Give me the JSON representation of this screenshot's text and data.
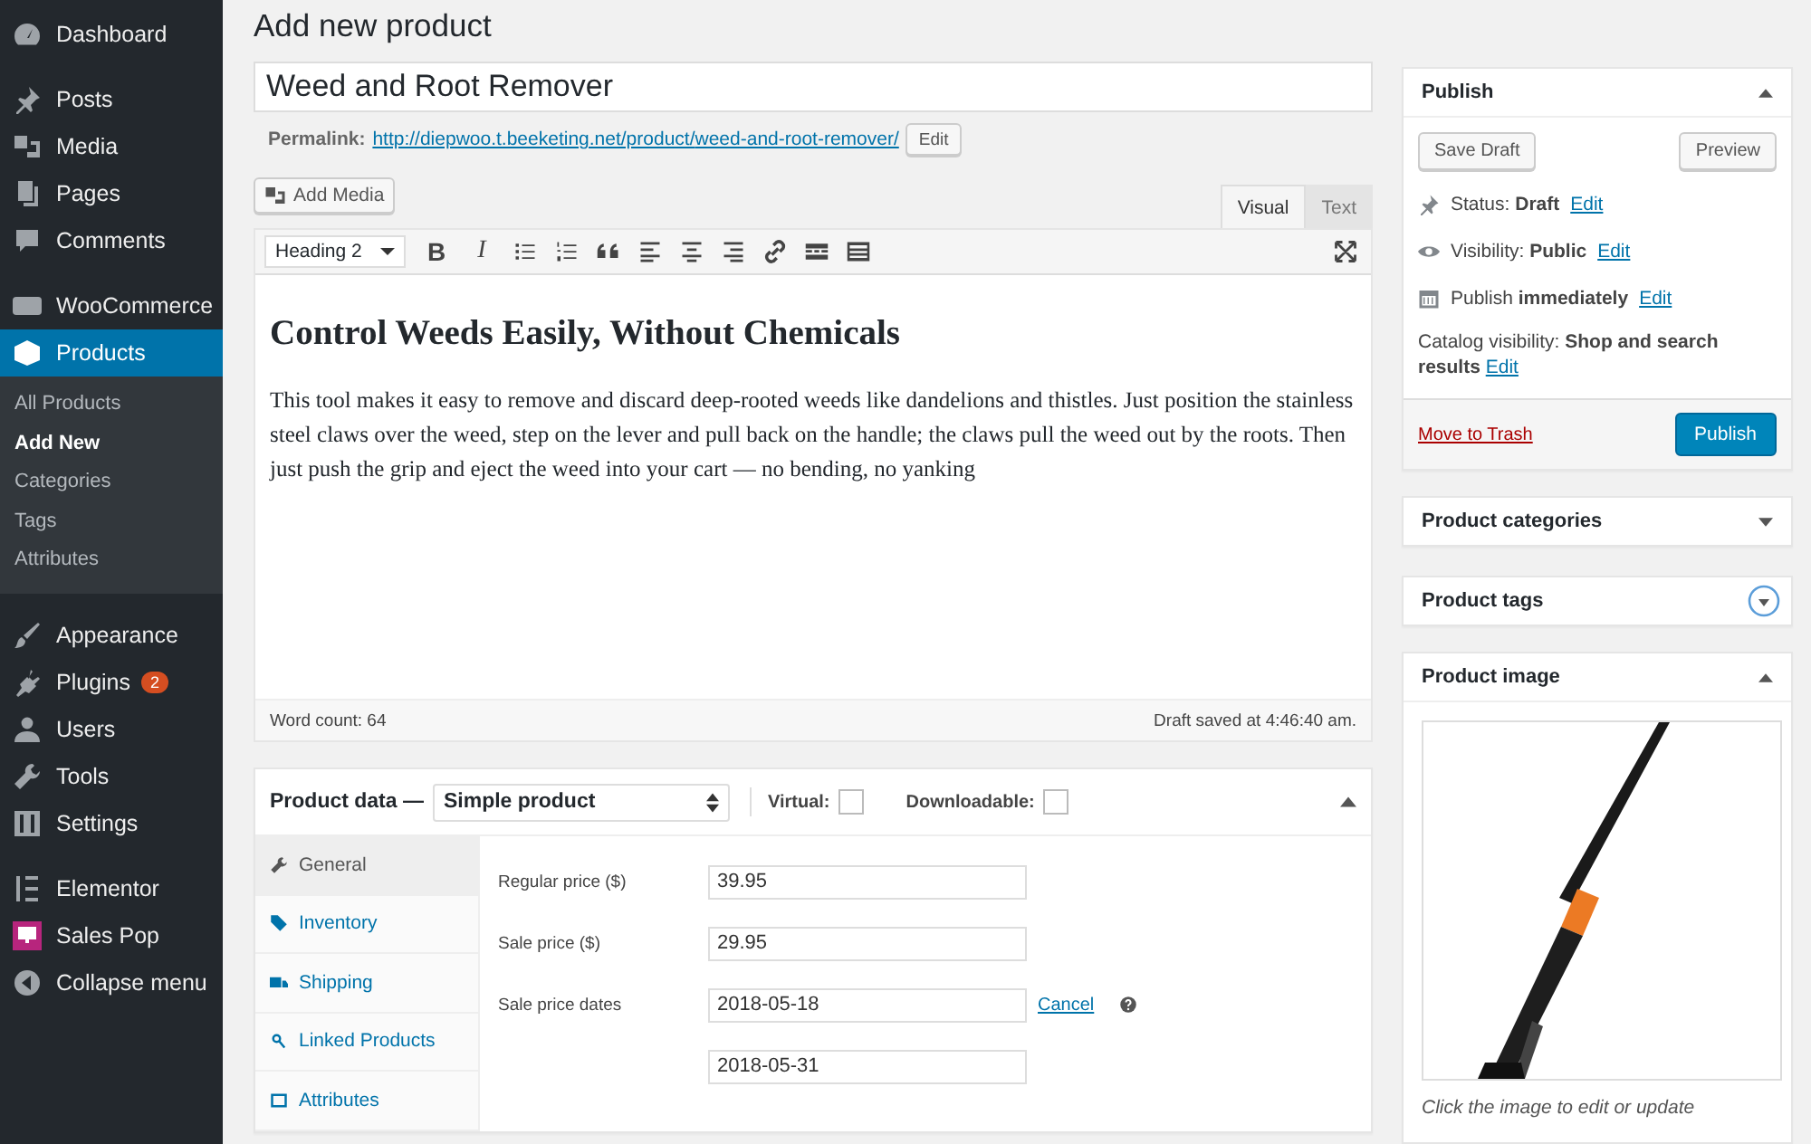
{
  "sidebar": {
    "groups": [
      [
        {
          "label": "Dashboard",
          "selected": false
        }
      ],
      [
        {
          "label": "Posts",
          "selected": false
        },
        {
          "label": "Media",
          "selected": false
        },
        {
          "label": "Pages",
          "selected": false
        },
        {
          "label": "Comments",
          "selected": false
        }
      ],
      [
        {
          "label": "WooCommerce",
          "selected": false
        },
        {
          "label": "Products",
          "selected": true,
          "children": [
            {
              "label": "All Products",
              "selected": false
            },
            {
              "label": "Add New",
              "selected": true
            },
            {
              "label": "Categories",
              "selected": false
            },
            {
              "label": "Tags",
              "selected": false
            },
            {
              "label": "Attributes",
              "selected": false
            }
          ]
        }
      ],
      [
        {
          "label": "Appearance",
          "selected": false
        },
        {
          "label": "Plugins",
          "selected": false,
          "badge": "2"
        },
        {
          "label": "Users",
          "selected": false
        },
        {
          "label": "Tools",
          "selected": false
        },
        {
          "label": "Settings",
          "selected": false
        }
      ],
      [
        {
          "label": "Elementor",
          "selected": false
        },
        {
          "label": "Sales Pop",
          "selected": false
        },
        {
          "label": "Collapse menu",
          "selected": false
        }
      ]
    ]
  },
  "page_title": "Add new product",
  "product_title": "Weed and Root Remover",
  "permalink": {
    "label": "Permalink:",
    "url_base": "http://diepwoo.t.beeketing.net/product/",
    "slug": "weed-and-root-remover/",
    "button": "Edit"
  },
  "editor": {
    "add_media": "Add Media",
    "tabs": [
      {
        "label": "Visual",
        "selected": true
      },
      {
        "label": "Text",
        "selected": false
      }
    ],
    "toolbar": {
      "format": "Heading 2",
      "bold": "B",
      "italic": "I"
    },
    "heading": "Control Weeds Easily, Without Chemicals",
    "body": "This tool makes it easy to remove and discard deep-rooted weeds like dandelions and thistles. Just position the stainless steel claws over the weed, step on the lever and pull back on the handle; the claws pull the weed out by the roots. Then just push the grip and eject the weed into your cart — no bending, no yanking",
    "word_count": "Word count: 64",
    "saved": "Draft saved at 4:46:40 am."
  },
  "product_data": {
    "label": "Product data —",
    "type": "Simple product",
    "virtual": {
      "label": "Virtual:",
      "checked": false
    },
    "downloadable": {
      "label": "Downloadable:",
      "checked": false
    },
    "tabs": [
      {
        "label": "General",
        "selected": true
      },
      {
        "label": "Inventory",
        "selected": false
      },
      {
        "label": "Shipping",
        "selected": false
      },
      {
        "label": "Linked Products",
        "selected": false
      },
      {
        "label": "Attributes",
        "selected": false
      }
    ],
    "fields": [
      {
        "label": "Regular price ($)",
        "value": "39.95"
      },
      {
        "label": "Sale price ($)",
        "value": "29.95"
      }
    ],
    "dates": {
      "label": "Sale price dates",
      "from": "2018-05-18",
      "to": "2018-05-31",
      "cancel": "Cancel"
    }
  },
  "publish": {
    "title": "Publish",
    "save_draft": "Save Draft",
    "preview": "Preview",
    "rows": [
      {
        "text": "Status: **Draft**",
        "edit": "Edit"
      },
      {
        "text": "Visibility: **Public**",
        "edit": "Edit"
      },
      {
        "text": "Publish **immediately**",
        "edit": "Edit"
      }
    ],
    "catalog": "Catalog visibility: **Shop and search results**",
    "catalog_edit": "Edit",
    "trash": "Move to Trash",
    "button": "Publish"
  },
  "boxes": [
    {
      "title": "Product categories",
      "expanded": false
    },
    {
      "title": "Product tags",
      "expanded": false
    }
  ],
  "product_image": {
    "title": "Product image",
    "hint": "Click the image to edit or update"
  }
}
